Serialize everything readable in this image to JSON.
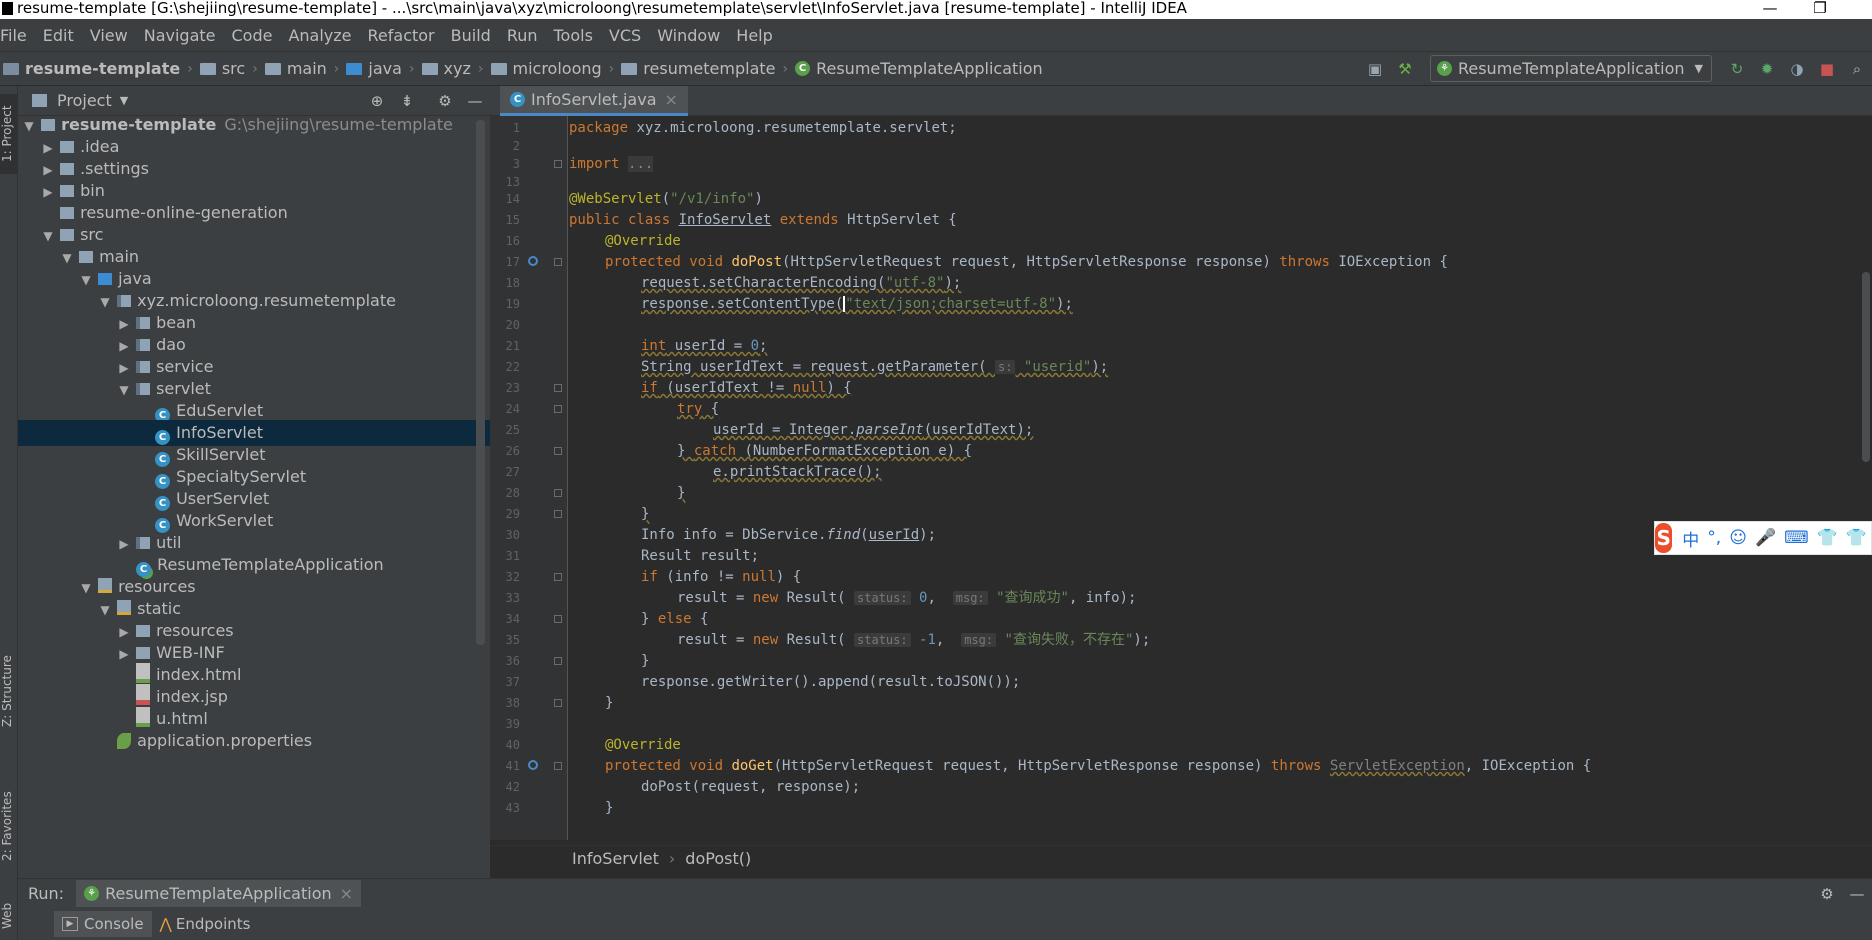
{
  "window": {
    "title": "resume-template [G:\\shejiing\\resume-template] - ...\\src\\main\\java\\xyz\\microloong\\resumetemplate\\servlet\\InfoServlet.java [resume-template] - IntelliJ IDEA",
    "minimize": "—",
    "restore": "❐"
  },
  "menu": [
    "File",
    "Edit",
    "View",
    "Navigate",
    "Code",
    "Analyze",
    "Refactor",
    "Build",
    "Run",
    "Tools",
    "VCS",
    "Window",
    "Help"
  ],
  "navbar": {
    "crumbs": [
      "resume-template",
      "src",
      "main",
      "java",
      "xyz",
      "microloong",
      "resumetemplate",
      "ResumeTemplateApplication"
    ],
    "run_config": "ResumeTemplateApplication"
  },
  "sidebar_labels": {
    "project": "1: Project",
    "structure": "Z: Structure",
    "favorites": "2: Favorites",
    "web": "Web"
  },
  "project_panel": {
    "title": "Project",
    "tree": [
      {
        "label": "resume-template",
        "extra": "G:\\shejiing\\resume-template",
        "depth": 0,
        "arrow": "▼",
        "icon": "folder",
        "bold": true
      },
      {
        "label": ".idea",
        "depth": 1,
        "arrow": "▶",
        "icon": "folder"
      },
      {
        "label": ".settings",
        "depth": 1,
        "arrow": "▶",
        "icon": "folder"
      },
      {
        "label": "bin",
        "depth": 1,
        "arrow": "▶",
        "icon": "folder"
      },
      {
        "label": "resume-online-generation",
        "depth": 1,
        "arrow": "",
        "icon": "folder"
      },
      {
        "label": "src",
        "depth": 1,
        "arrow": "▼",
        "icon": "folder"
      },
      {
        "label": "main",
        "depth": 2,
        "arrow": "▼",
        "icon": "folder"
      },
      {
        "label": "java",
        "depth": 3,
        "arrow": "▼",
        "icon": "folder-blue"
      },
      {
        "label": "xyz.microloong.resumetemplate",
        "depth": 4,
        "arrow": "▼",
        "icon": "package"
      },
      {
        "label": "bean",
        "depth": 5,
        "arrow": "▶",
        "icon": "package"
      },
      {
        "label": "dao",
        "depth": 5,
        "arrow": "▶",
        "icon": "package"
      },
      {
        "label": "service",
        "depth": 5,
        "arrow": "▶",
        "icon": "package"
      },
      {
        "label": "servlet",
        "depth": 5,
        "arrow": "▼",
        "icon": "package"
      },
      {
        "label": "EduServlet",
        "depth": 6,
        "arrow": "",
        "icon": "class"
      },
      {
        "label": "InfoServlet",
        "depth": 6,
        "arrow": "",
        "icon": "class",
        "selected": true
      },
      {
        "label": "SkillServlet",
        "depth": 6,
        "arrow": "",
        "icon": "class"
      },
      {
        "label": "SpecialtyServlet",
        "depth": 6,
        "arrow": "",
        "icon": "class"
      },
      {
        "label": "UserServlet",
        "depth": 6,
        "arrow": "",
        "icon": "class"
      },
      {
        "label": "WorkServlet",
        "depth": 6,
        "arrow": "",
        "icon": "class"
      },
      {
        "label": "util",
        "depth": 5,
        "arrow": "▶",
        "icon": "package"
      },
      {
        "label": "ResumeTemplateApplication",
        "depth": 5,
        "arrow": "",
        "icon": "spring"
      },
      {
        "label": "resources",
        "depth": 3,
        "arrow": "▼",
        "icon": "folder-res"
      },
      {
        "label": "static",
        "depth": 4,
        "arrow": "▼",
        "icon": "folder-res"
      },
      {
        "label": "resources",
        "depth": 5,
        "arrow": "▶",
        "icon": "folder"
      },
      {
        "label": "WEB-INF",
        "depth": 5,
        "arrow": "▶",
        "icon": "folder"
      },
      {
        "label": "index.html",
        "depth": 5,
        "arrow": "",
        "icon": "html"
      },
      {
        "label": "index.jsp",
        "depth": 5,
        "arrow": "",
        "icon": "jsp"
      },
      {
        "label": "u.html",
        "depth": 5,
        "arrow": "",
        "icon": "html"
      },
      {
        "label": "application.properties",
        "depth": 4,
        "arrow": "",
        "icon": "props"
      }
    ]
  },
  "editor": {
    "tab": "InfoServlet.java",
    "tab_close": "×",
    "line_numbers": [
      "1",
      "2",
      "3",
      "13",
      "14",
      "15",
      "16",
      "17",
      "18",
      "19",
      "20",
      "21",
      "22",
      "23",
      "24",
      "25",
      "26",
      "27",
      "28",
      "29",
      "30",
      "31",
      "32",
      "33",
      "34",
      "35",
      "36",
      "37",
      "38",
      "39",
      "40",
      "41",
      "42",
      "43"
    ],
    "breadcrumb": [
      "InfoServlet",
      "doPost()"
    ]
  },
  "code_text": {
    "l1_kw": "package",
    "l1_rest": " xyz.microloong.resumetemplate.servlet;",
    "l3_kw": "import",
    "l3_fold": "...",
    "l14_ann": "@WebServlet",
    "l14_p": "(",
    "l14_str": "\"/v1/info\"",
    "l14_e": ")",
    "l15_kw": "public class ",
    "l15_cls": "InfoServlet",
    "l15_kw2": " extends ",
    "l15_rest": "HttpServlet {",
    "l16_ann": "@Override",
    "l17_kw": "protected void ",
    "l17_fn": "doPost",
    "l17_rest": "(HttpServletRequest request, HttpServletResponse response) ",
    "l17_kw2": "throws",
    "l17_end": " IOException {",
    "l18_a": "request.setCharacterEncoding(",
    "l18_str": "\"utf-8\"",
    "l18_e": ");",
    "l19_a": "response.setContentType(",
    "l19_str": "\"text/json;charset=utf-8\"",
    "l19_e": ");",
    "l21_kw": "int",
    "l21_rest": " userId = ",
    "l21_num": "0",
    "l21_e": ";",
    "l22_a": "String userIdText = request.getParameter( ",
    "l22_hint": "s:",
    "l22_str": " \"userid\"",
    "l22_e": ");",
    "l23_kw": "if",
    "l23_a": " (userIdText != ",
    "l23_kw2": "null",
    "l23_e": ") {",
    "l24_kw": "try",
    "l24_e": " {",
    "l25_a": "userId = Integer.",
    "l25_fn": "parseInt",
    "l25_e": "(userIdText);",
    "l26_a": "} ",
    "l26_kw": "catch",
    "l26_e": " (NumberFormatException e) {",
    "l27_a": "e.printStackTrace();",
    "l28_a": "}",
    "l29_a": "}",
    "l30_a": "Info info = DbService.",
    "l30_fn": "find",
    "l30_p": "(",
    "l30_ul": "userId",
    "l30_e": ");",
    "l31_a": "Result result;",
    "l32_kw": "if",
    "l32_a": " (info != ",
    "l32_kw2": "null",
    "l32_e": ") {",
    "l33_a": "result = ",
    "l33_kw": "new",
    "l33_b": " Result( ",
    "l33_h1": "status:",
    "l33_n": " 0",
    "l33_c": ",  ",
    "l33_h2": "msg:",
    "l33_str": " \"查询成功\"",
    "l33_e": ", info);",
    "l34_a": "} ",
    "l34_kw": "else",
    "l34_e": " {",
    "l35_a": "result = ",
    "l35_kw": "new",
    "l35_b": " Result( ",
    "l35_h1": "status:",
    "l35_n": " -1",
    "l35_c": ",  ",
    "l35_h2": "msg:",
    "l35_str": " \"查询失败，不存在\"",
    "l35_e": ");",
    "l36_a": "}",
    "l37_a": "response.getWriter().append(result.toJSON());",
    "l38_a": "}",
    "l40_ann": "@Override",
    "l41_kw": "protected void ",
    "l41_fn": "doGet",
    "l41_rest": "(HttpServletRequest request, HttpServletResponse response) ",
    "l41_kw2": "throws",
    "l41_sp": " ",
    "l41_ex": "ServletException",
    "l41_end": ", IOException {",
    "l42_a": "doPost(request, response);",
    "l43_a": "}"
  },
  "ime": {
    "logo": "S",
    "items": [
      "中",
      "°,",
      "☺",
      "🎤",
      "⌨",
      "👕",
      "👕"
    ]
  },
  "run_panel": {
    "label": "Run:",
    "config": "ResumeTemplateApplication",
    "close": "×",
    "tabs": [
      "Console",
      "Endpoints"
    ]
  },
  "colors": {
    "keyword": "#cc7832",
    "string": "#6a8759",
    "annotation": "#bbb529",
    "method": "#ffc66d",
    "selection": "#0d293e"
  }
}
